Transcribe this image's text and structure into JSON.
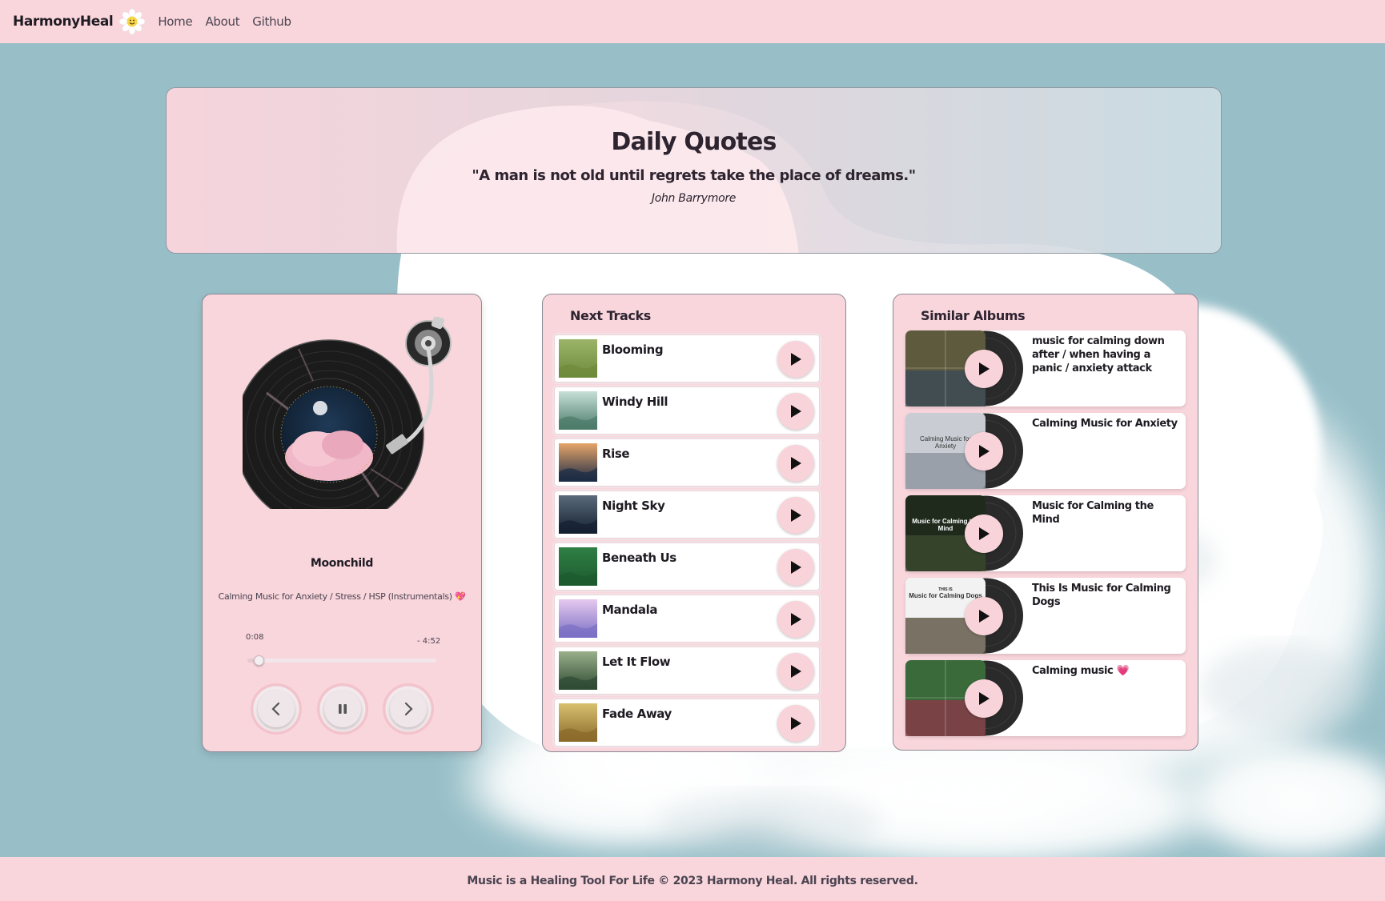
{
  "navbar": {
    "brand": "HarmonyHeal",
    "links": [
      "Home",
      "About",
      "Github"
    ]
  },
  "quote": {
    "title": "Daily Quotes",
    "text": "\"A man is not old until regrets take the place of dreams.\"",
    "author": "John Barrymore"
  },
  "player": {
    "song_title": "Moonchild",
    "artist": "Calming Music for Anxiety / Stress / HSP (Instrumentals) 💖",
    "time_elapsed": "0:08",
    "time_remaining": "- 4:52",
    "progress": 0.06
  },
  "tracks": {
    "title": "Next Tracks",
    "items": [
      {
        "name": "Blooming"
      },
      {
        "name": "Windy Hill"
      },
      {
        "name": "Rise"
      },
      {
        "name": "Night Sky"
      },
      {
        "name": "Beneath Us"
      },
      {
        "name": "Mandala"
      },
      {
        "name": "Let It Flow"
      },
      {
        "name": "Fade Away"
      }
    ]
  },
  "albums": {
    "title": "Similar Albums",
    "items": [
      {
        "name": "music for calming down after / when having a panic / anxiety attack"
      },
      {
        "name": "Calming Music for Anxiety",
        "cover_text": "Calming Music for Anxiety"
      },
      {
        "name": "Music for Calming the Mind",
        "cover_text": "Music for Calming the Mind"
      },
      {
        "name": "This Is Music for Calming Dogs",
        "cover_text_small": "THIS IS",
        "cover_text": "Music for Calming Dogs"
      },
      {
        "name": "Calming music 💗"
      }
    ]
  },
  "footer": {
    "text": "Music is a Healing Tool For Life © 2023 Harmony Heal. All rights reserved."
  },
  "colors": {
    "background": "#98bfc8",
    "pink": "#f9d5dc",
    "text": "#2d2430"
  }
}
